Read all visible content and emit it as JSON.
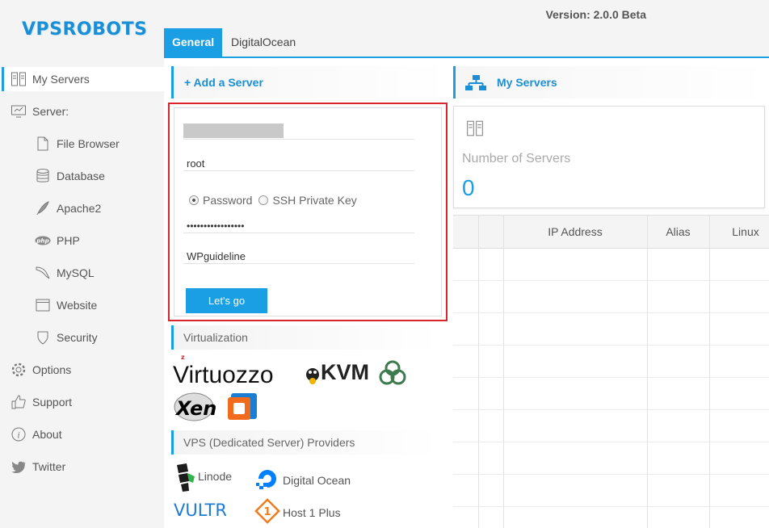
{
  "app": {
    "logo": "VPSROBOTS",
    "version": "Version: 2.0.0 Beta"
  },
  "tabs": [
    {
      "label": "General",
      "active": true
    },
    {
      "label": "DigitalOcean",
      "active": false
    }
  ],
  "sidebar": {
    "items": [
      {
        "label": "My Servers",
        "icon": "servers-icon",
        "active": true
      },
      {
        "label": "Server:",
        "icon": "monitor-icon"
      },
      {
        "label": "File Browser",
        "icon": "file-icon"
      },
      {
        "label": "Database",
        "icon": "database-icon"
      },
      {
        "label": "Apache2",
        "icon": "feather-icon"
      },
      {
        "label": "PHP",
        "icon": "php-icon"
      },
      {
        "label": "MySQL",
        "icon": "dolphin-icon"
      },
      {
        "label": "Website",
        "icon": "browser-window-icon"
      },
      {
        "label": "Security",
        "icon": "shield-icon"
      },
      {
        "label": "Options",
        "icon": "gear-icon"
      },
      {
        "label": "Support",
        "icon": "thumbs-up-icon"
      },
      {
        "label": "About",
        "icon": "info-icon"
      },
      {
        "label": "Twitter",
        "icon": "twitter-icon"
      }
    ]
  },
  "add_server": {
    "title": "+ Add a Server",
    "username": "root",
    "auth_password_label": "Password",
    "auth_key_label": "SSH Private Key",
    "auth_selected": "Password",
    "password_masked": "•••••••••••••••••",
    "alias": "WPguideline",
    "submit_label": "Let's go"
  },
  "virtualization": {
    "title": "Virtualization",
    "logos": [
      "Virtuozzo",
      "KVM",
      "Xen"
    ]
  },
  "providers": {
    "title": "VPS (Dedicated Server) Providers",
    "items": [
      "Linode",
      "Digital Ocean",
      "VULTR",
      "Host 1 Plus"
    ]
  },
  "my_servers": {
    "title": "My Servers",
    "stat_label": "Number of Servers",
    "stat_value": "0",
    "columns": [
      "",
      "",
      "IP Address",
      "Alias",
      "Linux"
    ]
  },
  "colors": {
    "accent": "#1a9ee4",
    "highlight_border": "#d9262e",
    "sidebar_bg": "#f4f4f4"
  }
}
